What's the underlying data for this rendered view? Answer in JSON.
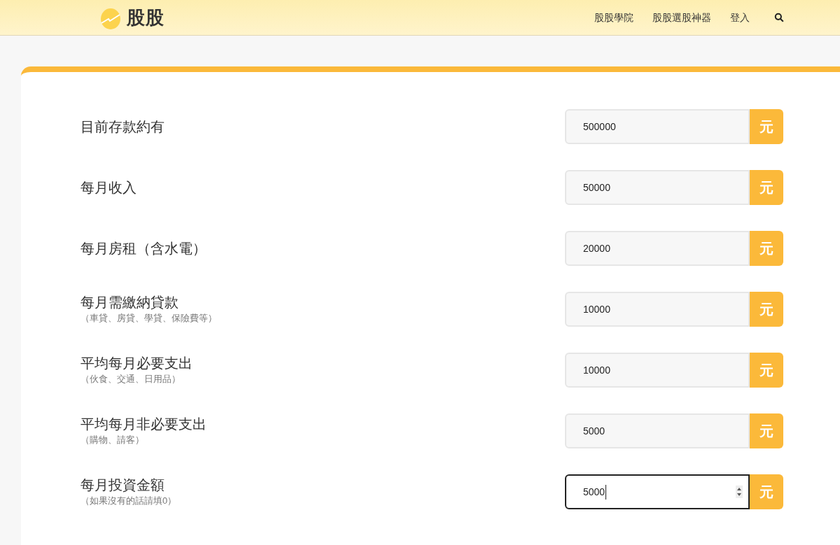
{
  "header": {
    "logo": "股股",
    "nav": [
      {
        "label": "股股學院"
      },
      {
        "label": "股股選股神器"
      },
      {
        "label": "登入"
      }
    ]
  },
  "fields": [
    {
      "label": "目前存款約有",
      "value": "500000",
      "unit": "元",
      "focused": false
    },
    {
      "label": "每月收入",
      "value": "50000",
      "unit": "元",
      "focused": false
    },
    {
      "label": "每月房租（含水電）",
      "value": "20000",
      "unit": "元",
      "focused": false
    },
    {
      "label": "每月需繳納貸款",
      "note": "（車貸、房貸、學貸、保險費等）",
      "value": "10000",
      "unit": "元",
      "focused": false
    },
    {
      "label": "平均每月必要支出",
      "note": "（伙食、交通、日用品）",
      "value": "10000",
      "unit": "元",
      "focused": false
    },
    {
      "label": "平均每月非必要支出",
      "note": "（購物、請客）",
      "value": "5000",
      "unit": "元",
      "focused": false
    },
    {
      "label": "每月投資金額",
      "note": "（如果沒有的話請填0）",
      "value": "5000",
      "unit": "元",
      "focused": true
    }
  ]
}
